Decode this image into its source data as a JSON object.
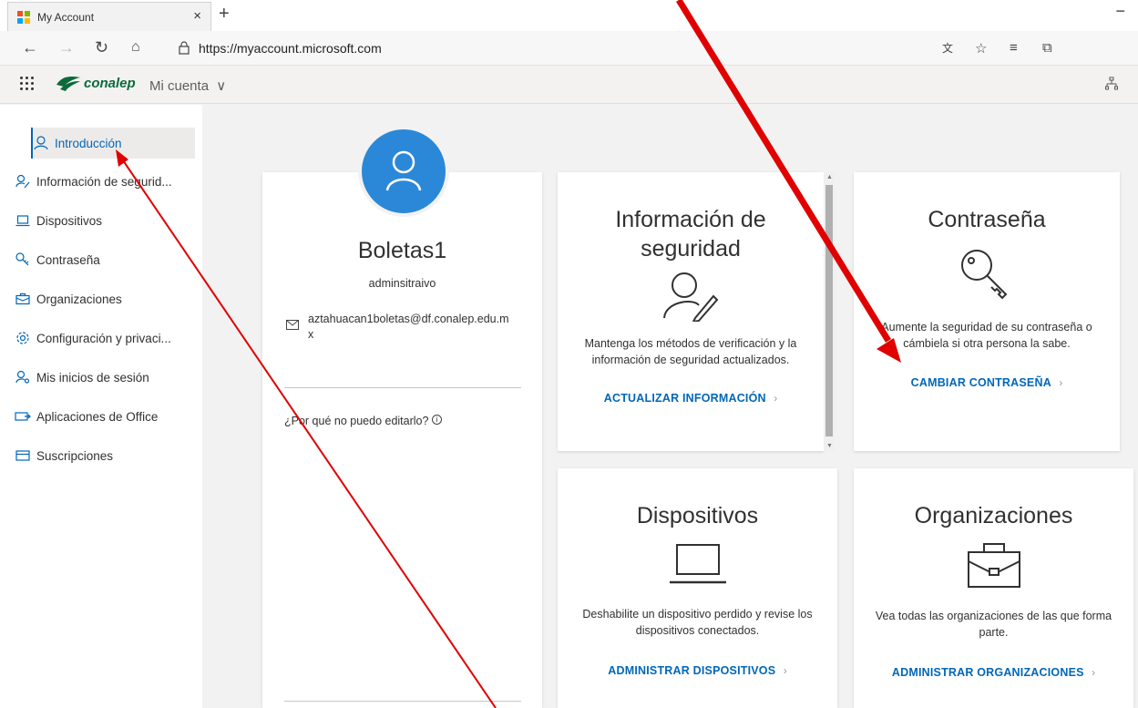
{
  "browser": {
    "tab_title": "My Account",
    "tab_close": "×",
    "new_tab": "+",
    "url": "https://myaccount.microsoft.com",
    "minimize": "−"
  },
  "header": {
    "logo_text": "conalep",
    "app_title": "Mi cuenta",
    "chevron": "∨"
  },
  "sidebar": {
    "items": [
      {
        "label": "Introducción"
      },
      {
        "label": "Información de segurid..."
      },
      {
        "label": "Dispositivos"
      },
      {
        "label": "Contraseña"
      },
      {
        "label": "Organizaciones"
      },
      {
        "label": "Configuración y privaci..."
      },
      {
        "label": "Mis inicios de sesión"
      },
      {
        "label": "Aplicaciones de Office"
      },
      {
        "label": "Suscripciones"
      }
    ]
  },
  "profile": {
    "name": "Boletas1",
    "role": "adminsitraivo",
    "email_line1": "aztahuacan1boletas@df.conalep.edu.m",
    "email_line2": "x",
    "why_edit": "¿Por qué no puedo editarlo?"
  },
  "cards": {
    "security": {
      "title_line1": "Información de",
      "title_line2": "seguridad",
      "desc_line1": "Mantenga los métodos de verificación y la",
      "desc_line2": "información de seguridad actualizados.",
      "link": "ACTUALIZAR INFORMACIÓN"
    },
    "password": {
      "title": "Contraseña",
      "desc_line1": "Aumente la seguridad de su contraseña o",
      "desc_line2": "cámbiela si otra persona la sabe.",
      "link": "CAMBIAR CONTRASEÑA"
    },
    "devices": {
      "title": "Dispositivos",
      "desc_line1": "Deshabilite un dispositivo perdido y revise los",
      "desc_line2": "dispositivos conectados.",
      "link": "ADMINISTRAR DISPOSITIVOS"
    },
    "organizations": {
      "title": "Organizaciones",
      "desc_line1": "Vea todas las organizaciones de las que forma",
      "desc_line2": "parte.",
      "link": "ADMINISTRAR ORGANIZACIONES"
    }
  },
  "colors": {
    "accent": "#0067b8",
    "avatar": "#2b88d8",
    "annotation": "#e00000"
  }
}
